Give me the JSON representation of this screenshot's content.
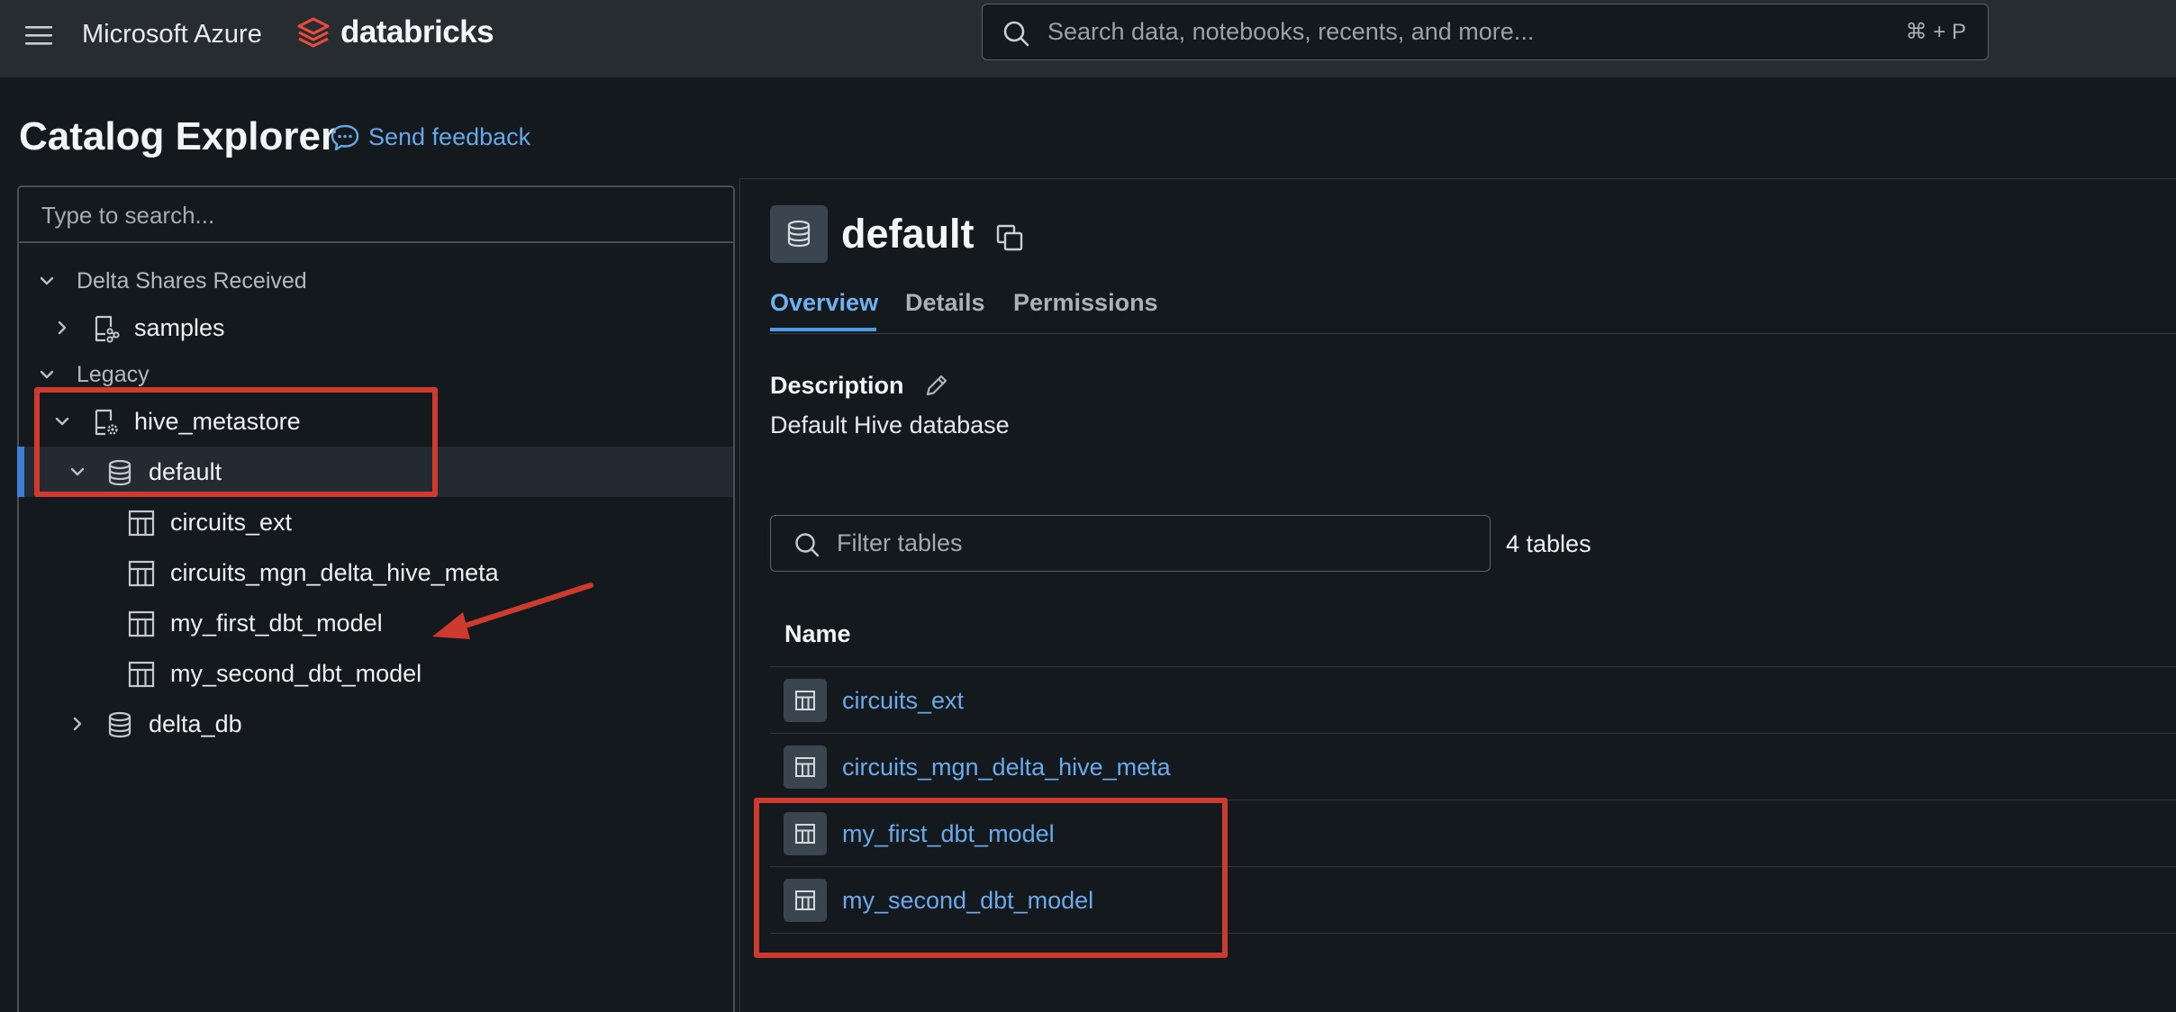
{
  "topbar": {
    "menu_icon": "hamburger-menu-icon",
    "cloud_name": "Microsoft Azure",
    "brand": "databricks",
    "brand_color": "#ea4b3b",
    "search_placeholder": "Search data, notebooks, recents, and more...",
    "search_shortcut": "⌘ + P"
  },
  "page": {
    "title": "Catalog Explorer",
    "feedback_label": "Send feedback",
    "link_color": "#66a7e8"
  },
  "tree": {
    "search_placeholder": "Type to search...",
    "sections": [
      {
        "label": "Delta Shares Received",
        "expanded": true
      },
      {
        "label": "Legacy",
        "expanded": true
      }
    ],
    "nodes": {
      "samples": {
        "label": "samples",
        "icon": "shared-catalog-icon",
        "expanded": false
      },
      "hive_metastore": {
        "label": "hive_metastore",
        "icon": "catalog-settings-icon",
        "expanded": true
      },
      "default": {
        "label": "default",
        "icon": "database-icon",
        "expanded": true,
        "selected": true
      },
      "tables": [
        {
          "label": "circuits_ext",
          "icon": "table-icon"
        },
        {
          "label": "circuits_mgn_delta_hive_meta",
          "icon": "table-icon"
        },
        {
          "label": "my_first_dbt_model",
          "icon": "table-icon"
        },
        {
          "label": "my_second_dbt_model",
          "icon": "table-icon"
        }
      ],
      "delta_db": {
        "label": "delta_db",
        "icon": "database-icon",
        "expanded": false
      }
    }
  },
  "schema": {
    "name": "default",
    "icon": "database-icon",
    "tabs": [
      "Overview",
      "Details",
      "Permissions"
    ],
    "active_tab": "Overview",
    "description_heading": "Description",
    "description": "Default Hive database",
    "filter_placeholder": "Filter tables",
    "table_count": "4 tables",
    "column_header": "Name",
    "tables": [
      {
        "name": "circuits_ext"
      },
      {
        "name": "circuits_mgn_delta_hive_meta"
      },
      {
        "name": "my_first_dbt_model"
      },
      {
        "name": "my_second_dbt_model"
      }
    ]
  },
  "annotations": {
    "color": "#cf3a2e",
    "highlights": [
      "hive_metastore and default in tree",
      "my_first_dbt_model and my_second_dbt_model in table list"
    ],
    "arrow_target": "my_first_dbt_model"
  }
}
